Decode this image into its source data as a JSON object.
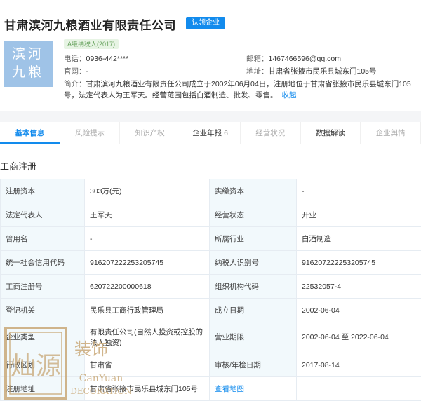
{
  "company": {
    "name": "甘肃滨河九粮酒业有限责任公司",
    "claim_label": "认领企业",
    "logo_line1": "滨河",
    "logo_line2": "九粮",
    "tax_badge": "A级纳税人(2017)"
  },
  "contact": {
    "phone_label": "电话：",
    "phone": "0936-442****",
    "website_label": "官网：",
    "website": "-",
    "email_label": "邮箱：",
    "email": "1467466596@qq.com",
    "address_label": "地址：",
    "address": "甘肃省张掖市民乐县城东门105号"
  },
  "intro": {
    "label": "简介：",
    "text": "甘肃滨河九粮酒业有限责任公司成立于2002年06月04日，注册地位于甘肃省张掖市民乐县城东门105号，法定代表人为王军天。经营范围包括白酒制造、批发、零售。",
    "collapse": "收起"
  },
  "tabs": [
    {
      "label": "基本信息",
      "count": ""
    },
    {
      "label": "风险提示",
      "count": ""
    },
    {
      "label": "知识产权",
      "count": ""
    },
    {
      "label": "企业年报",
      "count": "6"
    },
    {
      "label": "经营状况",
      "count": ""
    },
    {
      "label": "数据解读",
      "count": ""
    },
    {
      "label": "企业舆情",
      "count": ""
    }
  ],
  "section_title": "工商注册",
  "registration": [
    [
      "注册资本",
      "303万(元)",
      "实缴资本",
      "-"
    ],
    [
      "法定代表人",
      "王军天",
      "经营状态",
      "开业"
    ],
    [
      "曾用名",
      "-",
      "所属行业",
      "白酒制造"
    ],
    [
      "统一社会信用代码",
      "916207222253205745",
      "纳税人识别号",
      "916207222253205745"
    ],
    [
      "工商注册号",
      "620722200000618",
      "组织机构代码",
      "22532057-4"
    ],
    [
      "登记机关",
      "民乐县工商行政管理局",
      "成立日期",
      "2002-06-04"
    ],
    [
      "企业类型",
      "有限责任公司(自然人投资或控股的法人独资)",
      "营业期限",
      "2002-06-04 至 2022-06-04"
    ],
    [
      "行政区划",
      "甘肃省",
      "审核/年检日期",
      "2017-08-14"
    ],
    [
      "注册地址",
      "甘肃省张掖市民乐县城东门105号",
      "查看地图",
      ""
    ]
  ],
  "watermark": {
    "seal_chars": "灿源",
    "brand_cn": "装饰",
    "brand_en1": "CanYuan",
    "brand_en2": "DECORATION"
  },
  "colors": {
    "accent": "#128bed",
    "logo_bg": "#9fc3e7",
    "label_bg": "#f2f9fc",
    "badge_bg": "#e7f4e4",
    "badge_text": "#68a35f",
    "watermark": "#c9a978"
  }
}
